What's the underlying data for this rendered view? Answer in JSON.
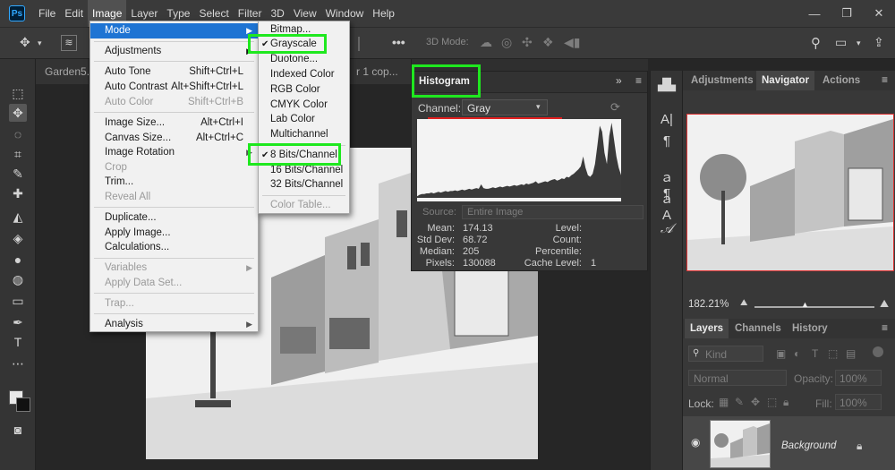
{
  "menubar": {
    "logo": "Ps",
    "items": [
      "File",
      "Edit",
      "Image",
      "Layer",
      "Type",
      "Select",
      "Filter",
      "3D",
      "View",
      "Window",
      "Help"
    ],
    "active": "Image",
    "window_controls": [
      "—",
      "❐",
      "✕"
    ]
  },
  "optionsbar": {
    "mode_label": "3D Mode:",
    "search_icon": "search-icon",
    "arrange_icon": "arrange-icon",
    "share_icon": "share-icon"
  },
  "tabs": [
    {
      "label": "Garden5."
    },
    {
      "label": "r 1 cop..."
    }
  ],
  "image_menu": {
    "mode": "Mode",
    "adjustments": "Adjustments",
    "auto_tone": {
      "label": "Auto Tone",
      "shortcut": "Shift+Ctrl+L"
    },
    "auto_contrast": {
      "label": "Auto Contrast",
      "shortcut": "Alt+Shift+Ctrl+L"
    },
    "auto_color": {
      "label": "Auto Color",
      "shortcut": "Shift+Ctrl+B"
    },
    "image_size": {
      "label": "Image Size...",
      "shortcut": "Alt+Ctrl+I"
    },
    "canvas_size": {
      "label": "Canvas Size...",
      "shortcut": "Alt+Ctrl+C"
    },
    "image_rotation": "Image Rotation",
    "crop": "Crop",
    "trim": "Trim...",
    "reveal_all": "Reveal All",
    "duplicate": "Duplicate...",
    "apply_image": "Apply Image...",
    "calculations": "Calculations...",
    "variables": "Variables",
    "apply_data_set": "Apply Data Set...",
    "trap": "Trap...",
    "analysis": "Analysis"
  },
  "mode_menu": {
    "bitmap": "Bitmap...",
    "grayscale": "Grayscale",
    "duotone": "Duotone...",
    "indexed": "Indexed Color",
    "rgb": "RGB Color",
    "cmyk": "CMYK Color",
    "lab": "Lab Color",
    "multichannel": "Multichannel",
    "b8": "8 Bits/Channel",
    "b16": "16 Bits/Channel",
    "b32": "32 Bits/Channel",
    "color_table": "Color Table...",
    "check": "✔"
  },
  "histogram": {
    "title": "Histogram",
    "channel_label": "Channel:",
    "channel_value": "Gray",
    "source_label": "Source:",
    "source_value": "Entire Image",
    "mean_label": "Mean:",
    "mean": "174.13",
    "stddev_label": "Std Dev:",
    "stddev": "68.72",
    "median_label": "Median:",
    "median": "205",
    "pixels_label": "Pixels:",
    "pixels": "130088",
    "level_label": "Level:",
    "count_label": "Count:",
    "percentile_label": "Percentile:",
    "cache_label": "Cache Level:",
    "cache": "1"
  },
  "chart_data": {
    "type": "area",
    "values": [
      2,
      4,
      5,
      5,
      6,
      6,
      7,
      6,
      7,
      8,
      7,
      8,
      9,
      8,
      9,
      9,
      10,
      9,
      10,
      11,
      10,
      11,
      12,
      11,
      12,
      13,
      12,
      18,
      13,
      12,
      12,
      13,
      14,
      13,
      14,
      15,
      14,
      15,
      16,
      15,
      16,
      17,
      16,
      17,
      18,
      17,
      19,
      18,
      19,
      20,
      22,
      19,
      20,
      21,
      22,
      21,
      23,
      24,
      25,
      23,
      24,
      26,
      25,
      28,
      27,
      30,
      32,
      35,
      38,
      42,
      55,
      40,
      30,
      28,
      32,
      45,
      70,
      96,
      88,
      60,
      45,
      82,
      100,
      78,
      55,
      40,
      30
    ]
  },
  "right_panels": {
    "tabs": [
      "Adjustments",
      "Navigator",
      "Actions"
    ],
    "active": "Navigator",
    "zoom": "182.21%"
  },
  "layers_panel": {
    "tabs": [
      "Layers",
      "Channels",
      "History"
    ],
    "kind": "Kind",
    "blend": "Normal",
    "opacity_label": "Opacity:",
    "opacity": "100%",
    "fill_label": "Fill:",
    "fill": "100%",
    "lock_label": "Lock:",
    "layer_name": "Background"
  }
}
